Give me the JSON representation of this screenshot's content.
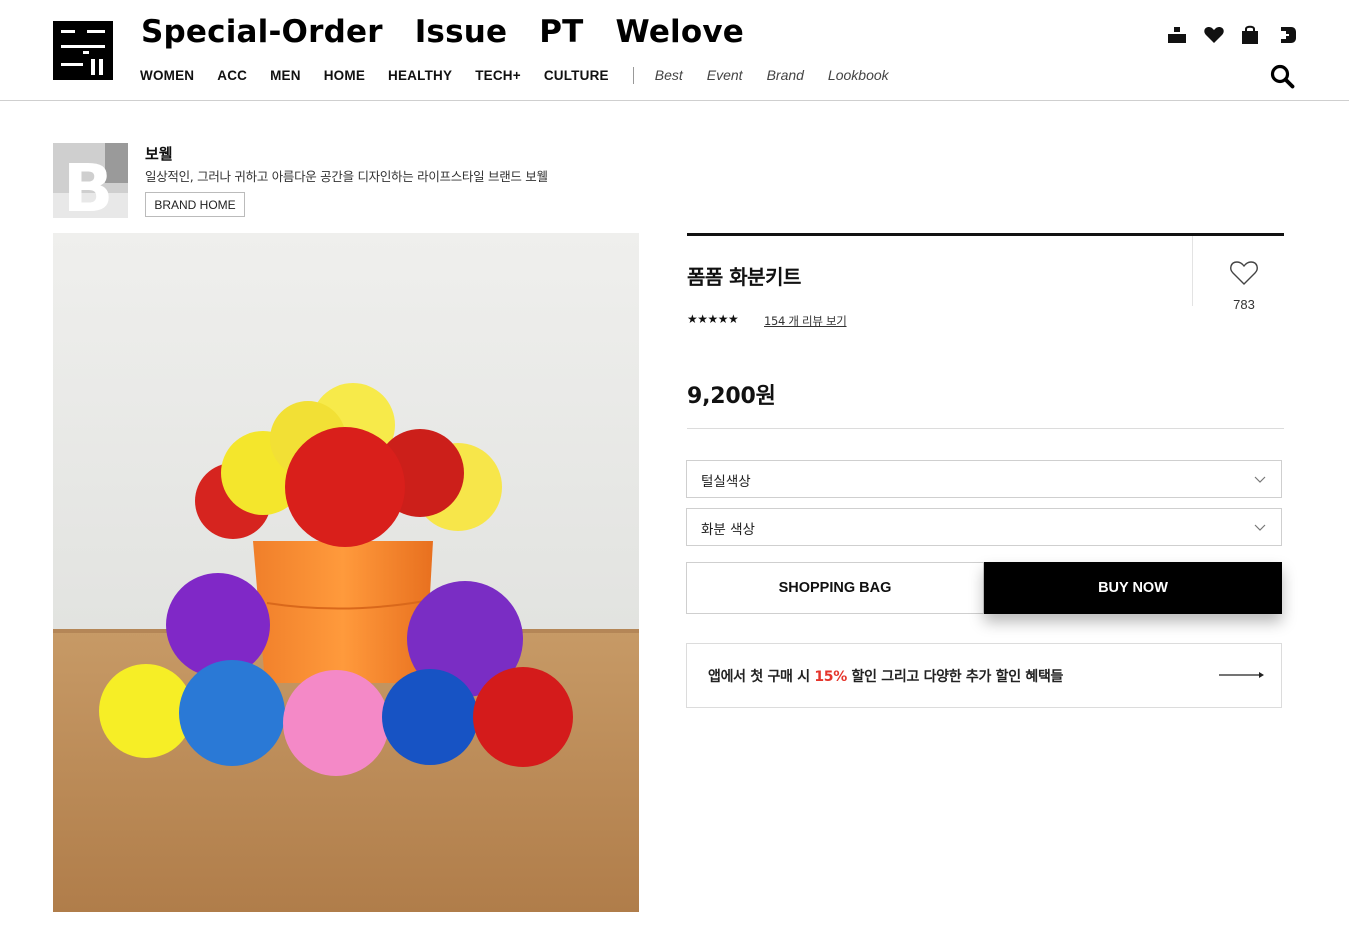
{
  "header": {
    "top_links": [
      "Special-Order",
      "Issue",
      "PT",
      "Welove"
    ],
    "nav_items": [
      "WOMEN",
      "ACC",
      "MEN",
      "HOME",
      "HEALTHY",
      "TECH+",
      "CULTURE"
    ],
    "nav_sub_items": [
      "Best",
      "Event",
      "Brand",
      "Lookbook"
    ],
    "icons": [
      "my-page-icon",
      "wishlist-heart-icon",
      "shopping-bag-icon",
      "logout-icon",
      "search-icon"
    ]
  },
  "brand": {
    "thumb_letter": "B",
    "name": "보웰",
    "description": "일상적인, 그러나 귀하고 아름다운 공간을 디자인하는 라이프스타일 브랜드 보웰",
    "home_button": "BRAND HOME"
  },
  "product": {
    "title": "폼폼 화분키트",
    "like_count": "783",
    "stars": "★★★★★",
    "rating": 5,
    "review_link": "154 개 리뷰 보기",
    "price": "9,200원",
    "options": [
      "털실색상",
      "화분 색상"
    ],
    "shopping_bag_label": "SHOPPING BAG",
    "buy_now_label": "BUY NOW",
    "promo": {
      "before": "앱에서 첫 구매 시 ",
      "highlight": "15%",
      "after": " 할인 그리고 다양한 추가 할인 혜택들"
    }
  },
  "colors": {
    "accent": "#e5352b",
    "primary": "#000000",
    "border": "#cfcfcf"
  }
}
